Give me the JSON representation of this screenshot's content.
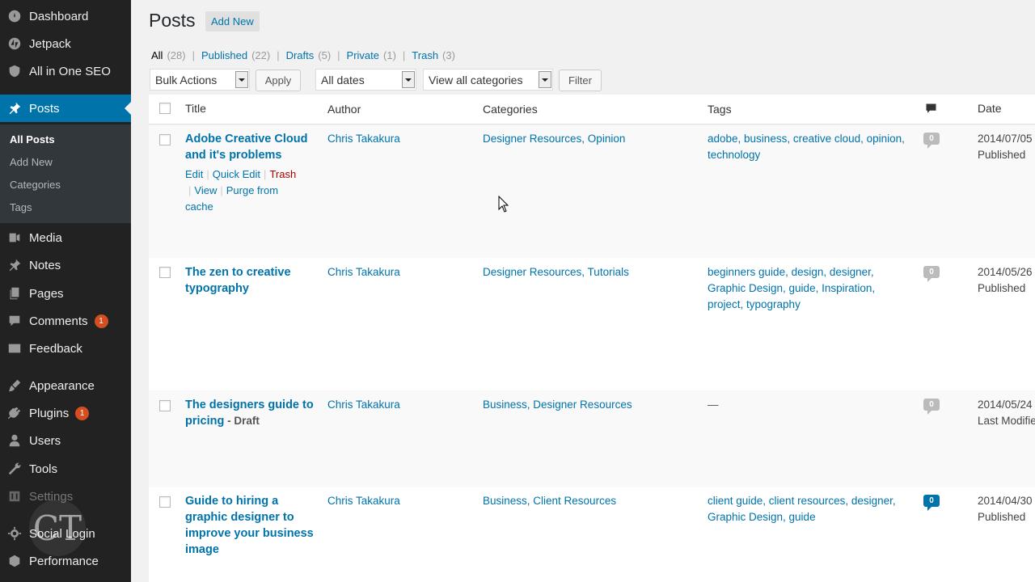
{
  "sidebar": {
    "items": [
      {
        "label": "Dashboard",
        "icon": "dashboard-icon"
      },
      {
        "label": "Jetpack",
        "icon": "jetpack-icon"
      },
      {
        "label": "All in One SEO",
        "icon": "shield-icon"
      },
      {
        "label": "Posts",
        "icon": "pin-icon",
        "active": true
      },
      {
        "label": "Media",
        "icon": "media-icon"
      },
      {
        "label": "Notes",
        "icon": "pin-icon"
      },
      {
        "label": "Pages",
        "icon": "pages-icon"
      },
      {
        "label": "Comments",
        "icon": "comment-icon",
        "badge": "1"
      },
      {
        "label": "Feedback",
        "icon": "feedback-icon"
      },
      {
        "label": "Appearance",
        "icon": "brush-icon"
      },
      {
        "label": "Plugins",
        "icon": "plugin-icon",
        "badge": "1"
      },
      {
        "label": "Users",
        "icon": "users-icon"
      },
      {
        "label": "Tools",
        "icon": "wrench-icon"
      },
      {
        "label": "Settings",
        "icon": "settings-icon"
      },
      {
        "label": "Social Login",
        "icon": "gear-icon"
      },
      {
        "label": "Performance",
        "icon": "performance-icon"
      }
    ],
    "submenu": [
      "All Posts",
      "Add New",
      "Categories",
      "Tags"
    ]
  },
  "watermark": "CT",
  "header": {
    "title": "Posts",
    "add_new": "Add New"
  },
  "filters": [
    {
      "label": "All",
      "count": "(28)",
      "current": true
    },
    {
      "label": "Published",
      "count": "(22)"
    },
    {
      "label": "Drafts",
      "count": "(5)"
    },
    {
      "label": "Private",
      "count": "(1)"
    },
    {
      "label": "Trash",
      "count": "(3)"
    }
  ],
  "toolbar": {
    "bulk_actions": "Bulk Actions",
    "apply": "Apply",
    "dates": "All dates",
    "categories": "View all categories",
    "filter": "Filter"
  },
  "table": {
    "columns": {
      "title": "Title",
      "author": "Author",
      "categories": "Categories",
      "tags": "Tags",
      "date": "Date"
    },
    "rows": [
      {
        "title_lines": [
          "Adobe Creative Cloud",
          "and it's problems"
        ],
        "draft": "",
        "author": "Chris Takakura",
        "categories": "Designer Resources, Opinion",
        "tags_lines": [
          "adobe, business, creative cloud, opinion,",
          "technology"
        ],
        "comments": "0",
        "date": "2014/07/05",
        "status": "Published",
        "actions": {
          "edit": "Edit",
          "quick_edit": "Quick Edit",
          "trash": "Trash",
          "view": "View",
          "purge": "Purge from",
          "purge2": "cache"
        }
      },
      {
        "title_lines": [
          "The zen to creative",
          "typography"
        ],
        "draft": "",
        "author": "Chris Takakura",
        "categories": "Designer Resources, Tutorials",
        "tags_lines": [
          "beginners guide, design, designer,",
          "Graphic Design, guide, Inspiration,",
          "project, typography"
        ],
        "comments": "0",
        "date": "2014/05/26",
        "status": "Published"
      },
      {
        "title_lines": [
          "The designers guide to",
          "pricing"
        ],
        "draft": " - Draft",
        "author": "Chris Takakura",
        "categories": "Business, Designer Resources",
        "tags_lines": [
          "—"
        ],
        "comments": "0",
        "date": "2014/05/24",
        "status": "Last Modified"
      },
      {
        "title_lines": [
          "Guide to hiring a",
          "graphic designer to",
          "improve your business",
          "image"
        ],
        "draft": "",
        "author": "Chris Takakura",
        "categories": "Business, Client Resources",
        "tags_lines": [
          "client guide, client resources, designer,",
          "Graphic Design, guide"
        ],
        "comments": "0",
        "comments_highlight": true,
        "date": "2014/04/30",
        "status": "Published"
      }
    ]
  }
}
